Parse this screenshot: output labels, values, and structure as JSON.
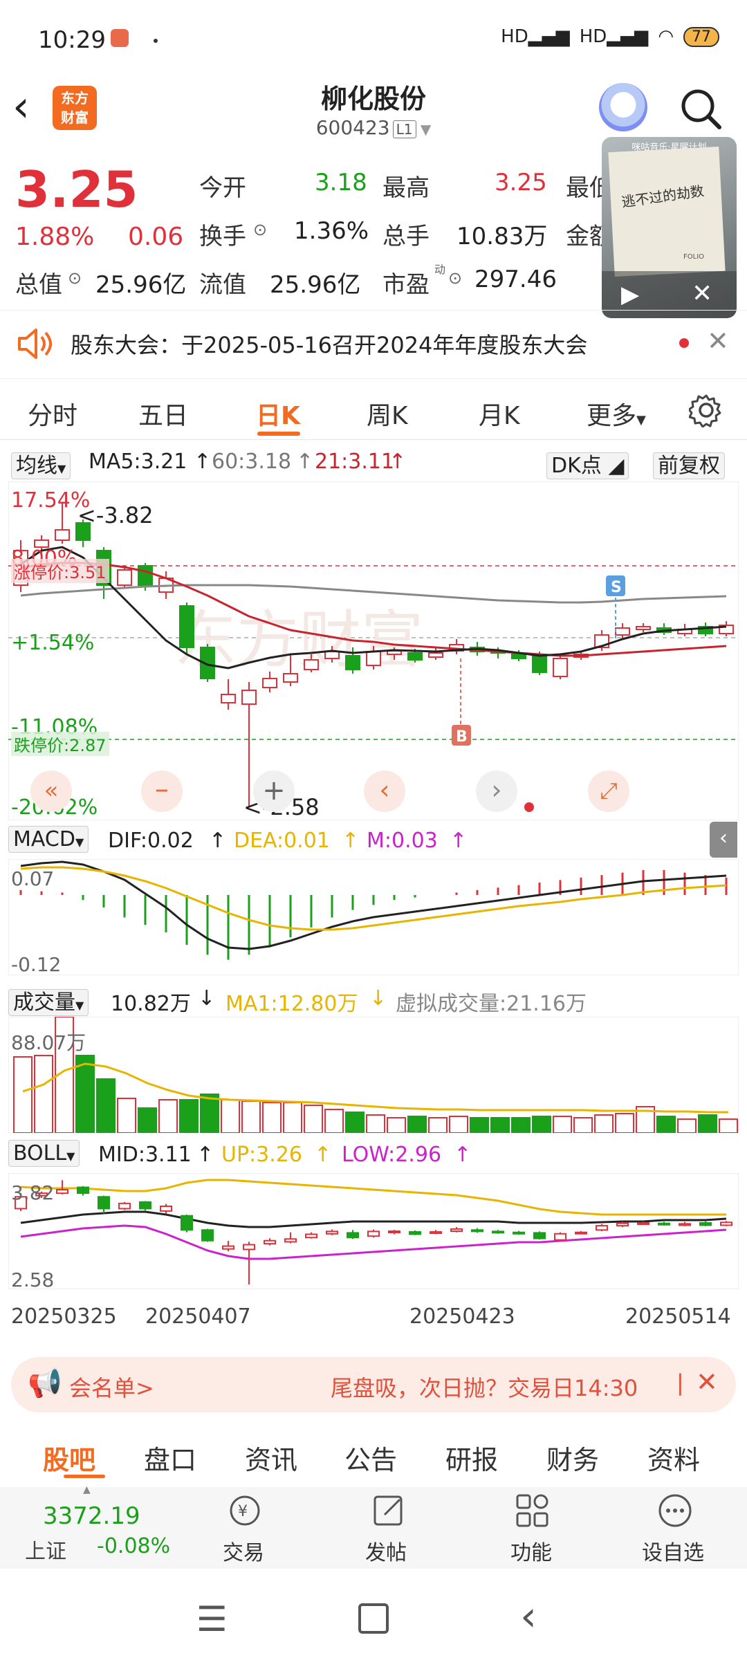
{
  "status_bar": {
    "time": "10:29",
    "network_1": "HD",
    "network_2": "HD",
    "battery": "77"
  },
  "header": {
    "stock_name": "柳化股份",
    "stock_code": "600423",
    "code_tag": "L1",
    "brand_logo_text": "东方\n财富"
  },
  "quote": {
    "price": "3.25",
    "change_pct": "1.88%",
    "change_abs": "0.06",
    "fields": [
      {
        "label": "今开",
        "value": "3.18",
        "color": "#1aa01a"
      },
      {
        "label": "最高",
        "value": "3.25",
        "color": "#e0303a"
      },
      {
        "label": "最低",
        "value": ""
      },
      {
        "label": "换手",
        "value": "1.36%",
        "color": "#222"
      },
      {
        "label": "总手",
        "value": "10.83万",
        "color": "#222"
      },
      {
        "label": "金额",
        "value": ""
      },
      {
        "label": "总值",
        "value": "25.96亿",
        "color": "#222"
      },
      {
        "label": "流值",
        "value": "25.96亿",
        "color": "#222"
      },
      {
        "label": "市盈",
        "value": "297.46",
        "color": "#222"
      }
    ],
    "pe_superscript": "动"
  },
  "video_overlay": {
    "header_text": "咪咕音乐·星曜计划",
    "caption": "逃不过的劫数",
    "small_tag": "FOLIO"
  },
  "notice": {
    "text": "股东大会：于2025-05-16召开2024年年度股东大会"
  },
  "tabs": [
    "分时",
    "五日",
    "日K",
    "周K",
    "月K",
    "更多"
  ],
  "active_tab": "日K",
  "ma_row": {
    "selector": "均线",
    "ma5": "MA5:3.21",
    "ma60": "60:3.18",
    "ma21": "21:3.11",
    "dk": "DK点",
    "adjust": "前复权"
  },
  "kline": {
    "pct_labels": [
      "17.54%",
      "8.00%",
      "+1.54%",
      "-11.08%",
      "-20.62%"
    ],
    "limit_up": "涨停价:3.51",
    "limit_down": "跌停价:2.87",
    "high_mark": "<-3.82",
    "low_mark": "<-2.58",
    "buy_marker": "B",
    "sell_marker": "S",
    "watermark": "东方财富"
  },
  "macd_row": {
    "selector": "MACD",
    "dif": "DIF:0.02",
    "dea": "DEA:0.01",
    "m": "M:0.03",
    "top": "0.07",
    "bottom": "-0.12"
  },
  "volume_row": {
    "selector": "成交量",
    "vol": "10.82万",
    "ma1": "MA1:12.80万",
    "virtual": "虚拟成交量:21.16万",
    "top": "88.07万"
  },
  "boll_row": {
    "selector": "BOLL",
    "mid": "MID:3.11",
    "up": "UP:3.26",
    "low": "LOW:2.96",
    "top": "3.82",
    "bottom": "2.58"
  },
  "dates": [
    "20250325",
    "20250407",
    "20250423",
    "20250514"
  ],
  "promo": {
    "left": "会名单>",
    "right": "尾盘吸，次日抛？交易日14:30"
  },
  "subtabs": [
    "股吧",
    "盘口",
    "资讯",
    "公告",
    "研报",
    "财务",
    "资料"
  ],
  "active_subtab": "股吧",
  "toolbar": {
    "index_value": "3372.19",
    "index_name": "上证",
    "index_change": "-0.08%",
    "items": [
      "交易",
      "发帖",
      "功能",
      "设自选"
    ]
  },
  "colors": {
    "up": "#e0303a",
    "down": "#1aa01a",
    "accent": "#f26b21",
    "ma5": "#222222",
    "ma21": "#c8242e",
    "ma60": "#888888",
    "dea": "#e7b400",
    "m": "#cc22cc"
  }
}
